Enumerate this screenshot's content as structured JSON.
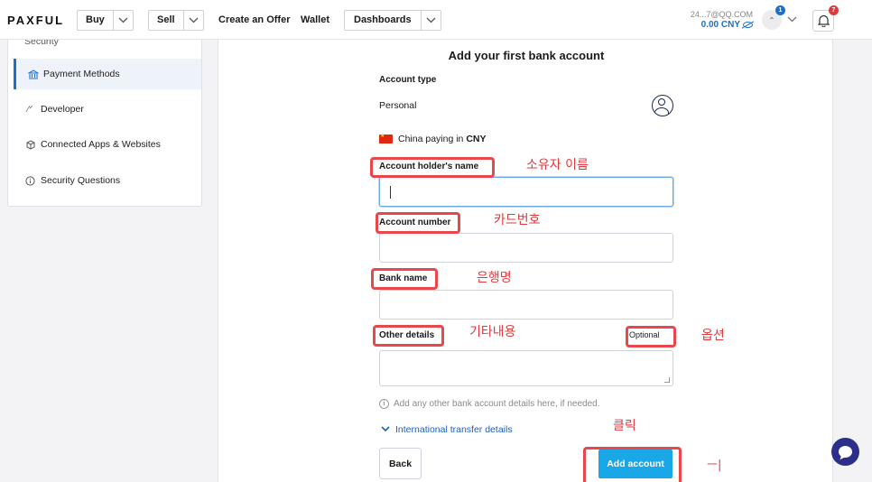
{
  "brand": {
    "logo": "PAXFUL"
  },
  "nav": {
    "buy": "Buy",
    "sell": "Sell",
    "create_offer": "Create an Offer",
    "wallet": "Wallet",
    "dashboards": "Dashboards"
  },
  "account": {
    "email": "24...7@QQ.COM",
    "balance": "0.00 CNY",
    "user_badge": "1",
    "notification_badge": "7"
  },
  "sidebar": {
    "partial_item": "Security",
    "items": [
      {
        "label": "Payment Methods",
        "icon": "bank-icon",
        "active": true
      },
      {
        "label": "Developer",
        "icon": "code-icon",
        "active": false
      },
      {
        "label": "Connected Apps & Websites",
        "icon": "cube-icon",
        "active": false
      },
      {
        "label": "Security Questions",
        "icon": "info-icon",
        "active": false
      }
    ]
  },
  "form": {
    "title": "Add your first bank account",
    "account_type_label": "Account type",
    "account_type_value": "Personal",
    "country_text": "China paying in ",
    "currency": "CNY",
    "holder_label": "Account holder's name",
    "number_label": "Account number",
    "bank_label": "Bank name",
    "other_label": "Other details",
    "optional_label": "Optional",
    "help_text": "Add any other bank account details here, if needed.",
    "intl_link": "International transfer details",
    "back_button": "Back",
    "add_button": "Add account"
  },
  "annotations": {
    "holder": "소유자 이름",
    "number": "카드번호",
    "bank": "은행명",
    "other": "기타내용",
    "optional": "옵션",
    "click": "클릭",
    "arrow": "ㅡ|"
  },
  "colors": {
    "accent": "#1aa7e8",
    "link": "#1d5fb8",
    "annotation": "#e8474c"
  }
}
